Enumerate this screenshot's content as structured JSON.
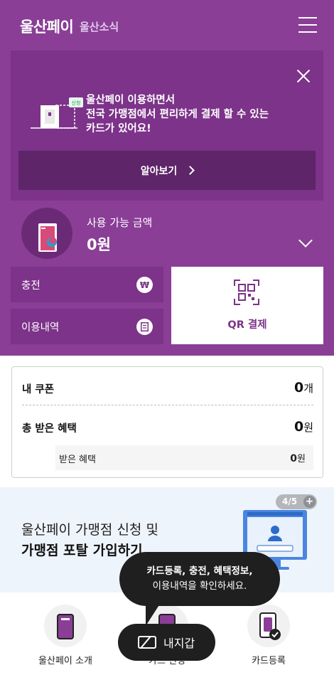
{
  "header": {
    "brand": "울산페이",
    "news_link": "울산소식"
  },
  "banner": {
    "badge": "신청",
    "lines": [
      "울산페이 이용하면서",
      "전국 가맹점에서 편리하게 결제 할 수 있는",
      "카드가 있어요!"
    ],
    "button": "알아보기"
  },
  "balance": {
    "label": "사용 가능 금액",
    "amount": "0원"
  },
  "actions": {
    "charge": "충전",
    "charge_icon": "₩",
    "history": "이용내역",
    "qr": "QR 결제"
  },
  "benefits": {
    "coupon_label": "내 쿠폰",
    "coupon_value": "0",
    "coupon_unit": "개",
    "total_label": "총 받은 혜택",
    "total_value": "0",
    "total_unit": "원",
    "received_label": "받은 혜택",
    "received_value": "0",
    "received_unit": "원"
  },
  "promo": {
    "line1": "울산페이 가맹점 신청 및",
    "line2": "가맹점 포탈 가입하기",
    "pager": "4/5",
    "plus": "+"
  },
  "bottom_nav": {
    "intro": "울산페이 소개",
    "middle": "카드 신청",
    "register": "카드등록"
  },
  "tooltip": {
    "bold": "카드등록, 충전, 혜택정보,",
    "rest": "이용내역을 확인하세요."
  },
  "wallet_button": "내지갑",
  "colors": {
    "primary": "#8a3e96",
    "banner": "#7c3389",
    "button_dark": "#5e2569",
    "tooltip": "#1f1f1f"
  }
}
